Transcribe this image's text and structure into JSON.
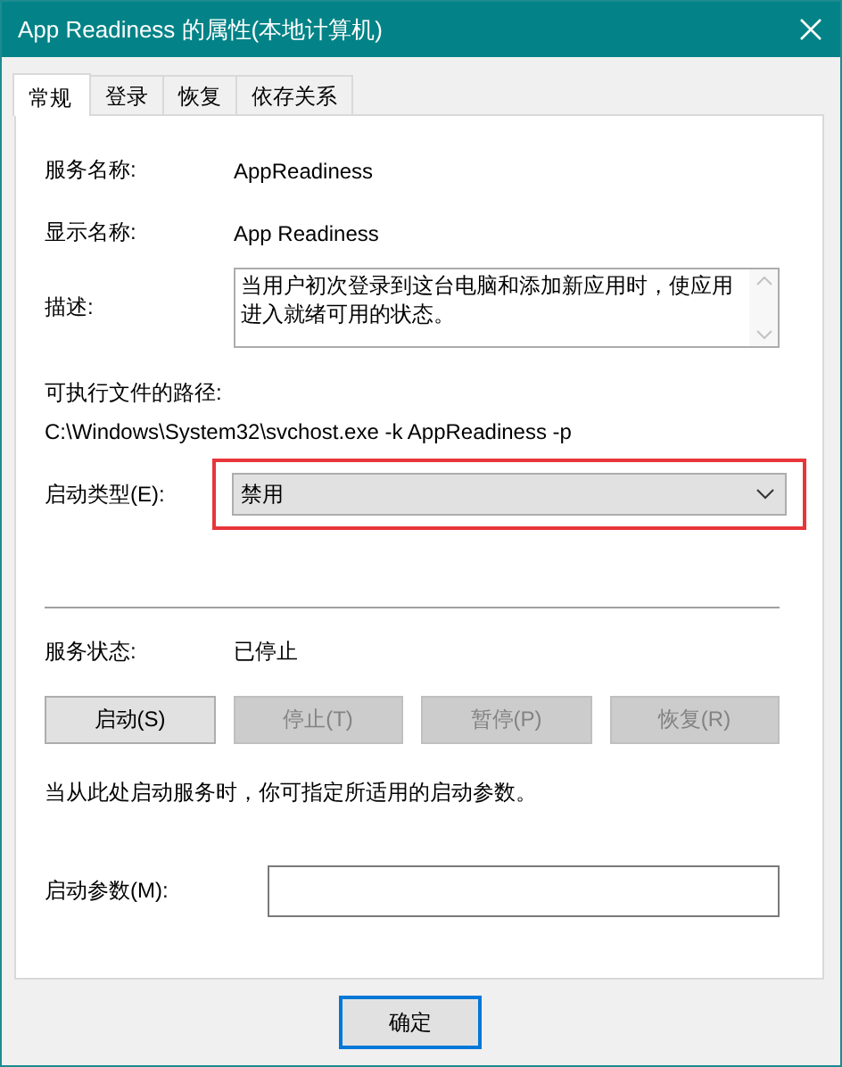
{
  "window": {
    "title": "App Readiness 的属性(本地计算机)"
  },
  "tabs": [
    {
      "label": "常规",
      "selected": true
    },
    {
      "label": "登录",
      "selected": false
    },
    {
      "label": "恢复",
      "selected": false
    },
    {
      "label": "依存关系",
      "selected": false
    }
  ],
  "service_name": {
    "label": "服务名称:",
    "value": "AppReadiness"
  },
  "display_name": {
    "label": "显示名称:",
    "value": "App Readiness"
  },
  "description": {
    "label": "描述:",
    "value": "当用户初次登录到这台电脑和添加新应用时，使应用进入就绪可用的状态。"
  },
  "path": {
    "label": "可执行文件的路径:",
    "value": "C:\\Windows\\System32\\svchost.exe -k AppReadiness -p"
  },
  "startup_type": {
    "label": "启动类型(E):",
    "value": "禁用",
    "highlighted": true
  },
  "service_status": {
    "label": "服务状态:",
    "value": "已停止"
  },
  "service_buttons": [
    {
      "label": "启动(S)",
      "disabled": false
    },
    {
      "label": "停止(T)",
      "disabled": true
    },
    {
      "label": "暂停(P)",
      "disabled": true
    },
    {
      "label": "恢复(R)",
      "disabled": true
    }
  ],
  "hint": "当从此处启动服务时，你可指定所适用的启动参数。",
  "start_params": {
    "label": "启动参数(M):"
  },
  "dialog_buttons": [
    {
      "label": "确定",
      "default": true
    }
  ]
}
